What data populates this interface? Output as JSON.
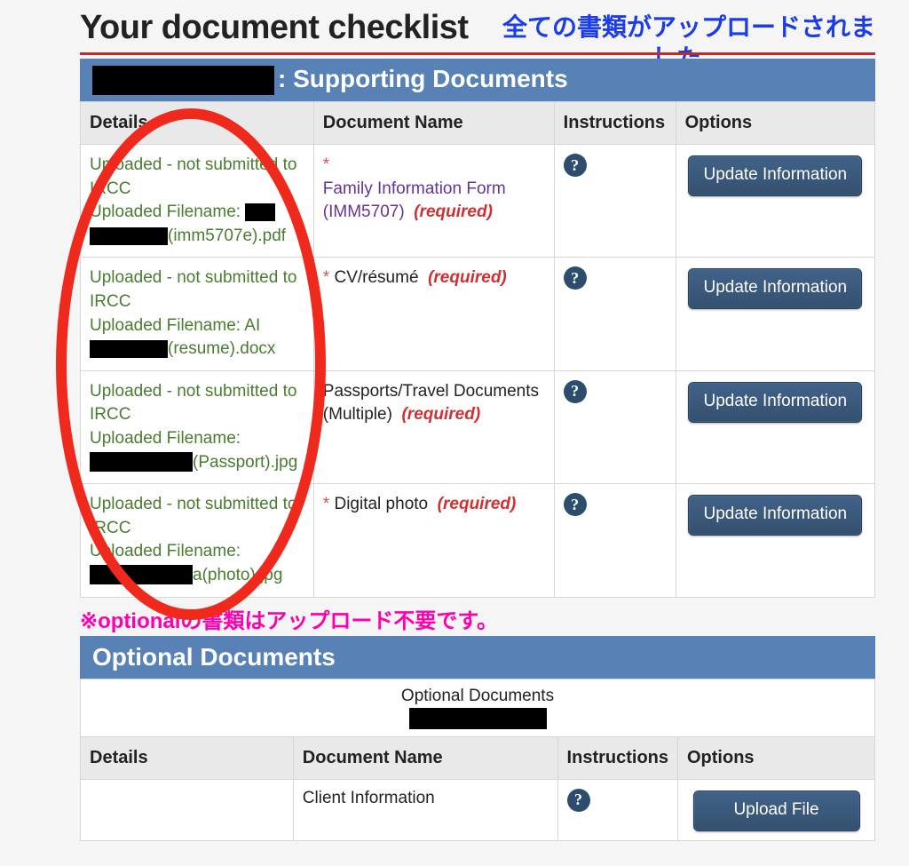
{
  "page": {
    "title": "Your document checklist",
    "upload_complete_ja": "全ての書類がアップロードされました。",
    "optional_note_ja": "※optionalの書類はアップロード不要です。"
  },
  "sections": {
    "supporting": {
      "title_suffix": ": Supporting Documents",
      "headers": {
        "details": "Details",
        "doc_name": "Document Name",
        "instructions": "Instructions",
        "options": "Options"
      },
      "rows": [
        {
          "status": "Uploaded - not submitted to IRCC",
          "filename_label": "Uploaded Filename:",
          "filename_suffix": "(imm5707e).pdf",
          "doc_name": "Family Information Form (IMM5707)",
          "required": "(required)",
          "button": "Update Information",
          "show_asterisk": true,
          "is_link": true
        },
        {
          "status": "Uploaded - not submitted to IRCC",
          "filename_label": "Uploaded Filename:  AI",
          "filename_suffix": "(resume).docx",
          "doc_name": "CV/résumé",
          "required": "(required)",
          "button": "Update Information",
          "show_asterisk": true,
          "is_link": false
        },
        {
          "status": "Uploaded - not submitted to IRCC",
          "filename_label": "Uploaded Filename:",
          "filename_suffix": "(Passport).jpg",
          "doc_name": "Passports/Travel Documents (Multiple)",
          "required": "(required)",
          "button": "Update Information",
          "show_asterisk": false,
          "is_link": false
        },
        {
          "status": "Uploaded - not submitted to IRCC",
          "filename_label": "Uploaded Filename:",
          "filename_suffix": "a(photo).jpg",
          "doc_name": "Digital photo",
          "required": "(required)",
          "button": "Update Information",
          "show_asterisk": true,
          "is_link": false
        }
      ]
    },
    "optional": {
      "title": "Optional Documents",
      "caption": "Optional Documents",
      "headers": {
        "details": "Details",
        "doc_name": "Document Name",
        "instructions": "Instructions",
        "options": "Options"
      },
      "rows": [
        {
          "details": "",
          "doc_name": "Client Information",
          "button": "Upload File"
        }
      ]
    }
  },
  "icons": {
    "help": "?"
  }
}
